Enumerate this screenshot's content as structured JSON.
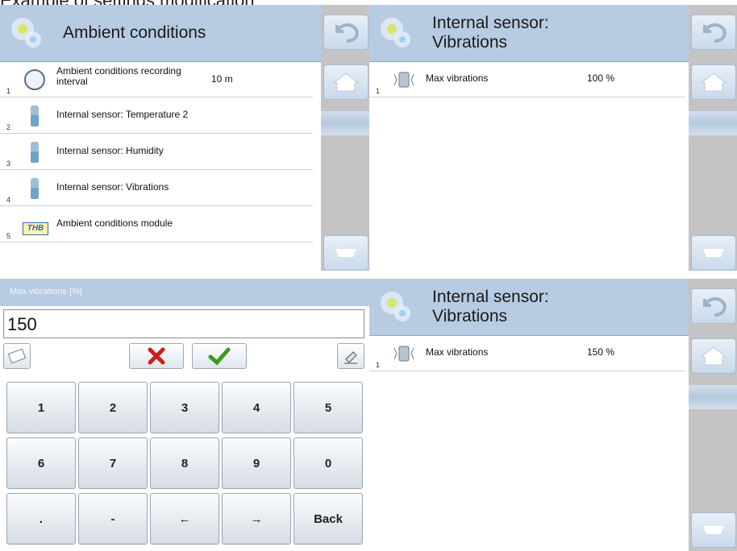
{
  "caption": "Example of settings modification",
  "panel_a": {
    "title": "Ambient conditions",
    "rows": [
      {
        "num": "1",
        "label": "Ambient conditions recording interval",
        "value": "10 m"
      },
      {
        "num": "2",
        "label": "Internal sensor: Temperature 2",
        "value": ""
      },
      {
        "num": "3",
        "label": "Internal sensor: Humidity",
        "value": ""
      },
      {
        "num": "4",
        "label": "Internal sensor: Vibrations",
        "value": ""
      },
      {
        "num": "5",
        "label": "Ambient conditions module",
        "value": "",
        "icon_text": "THB"
      }
    ]
  },
  "panel_b": {
    "title_line1": "Internal sensor:",
    "title_line2": "Vibrations",
    "rows": [
      {
        "num": "1",
        "label": "Max vibrations",
        "value": "100 %"
      }
    ]
  },
  "keypad": {
    "title": "Max vibrations [%]",
    "input_value": "150",
    "keys": [
      "1",
      "2",
      "3",
      "4",
      "5",
      "6",
      "7",
      "8",
      "9",
      "0",
      ".",
      "-",
      "←",
      "→",
      "Back"
    ]
  },
  "panel_d": {
    "title_line1": "Internal sensor:",
    "title_line2": "Vibrations",
    "rows": [
      {
        "num": "1",
        "label": "Max vibrations",
        "value": "150 %"
      }
    ]
  },
  "colors": {
    "header": "#b7cbe3",
    "sidebar": "#c4c4c4",
    "cancel": "#cc1f1f",
    "confirm": "#3a9a1e"
  },
  "icons": {
    "settings": "gear-icon",
    "back": "back-arrow-icon",
    "home": "home-icon",
    "scroll_down": "scroll-down-icon"
  }
}
